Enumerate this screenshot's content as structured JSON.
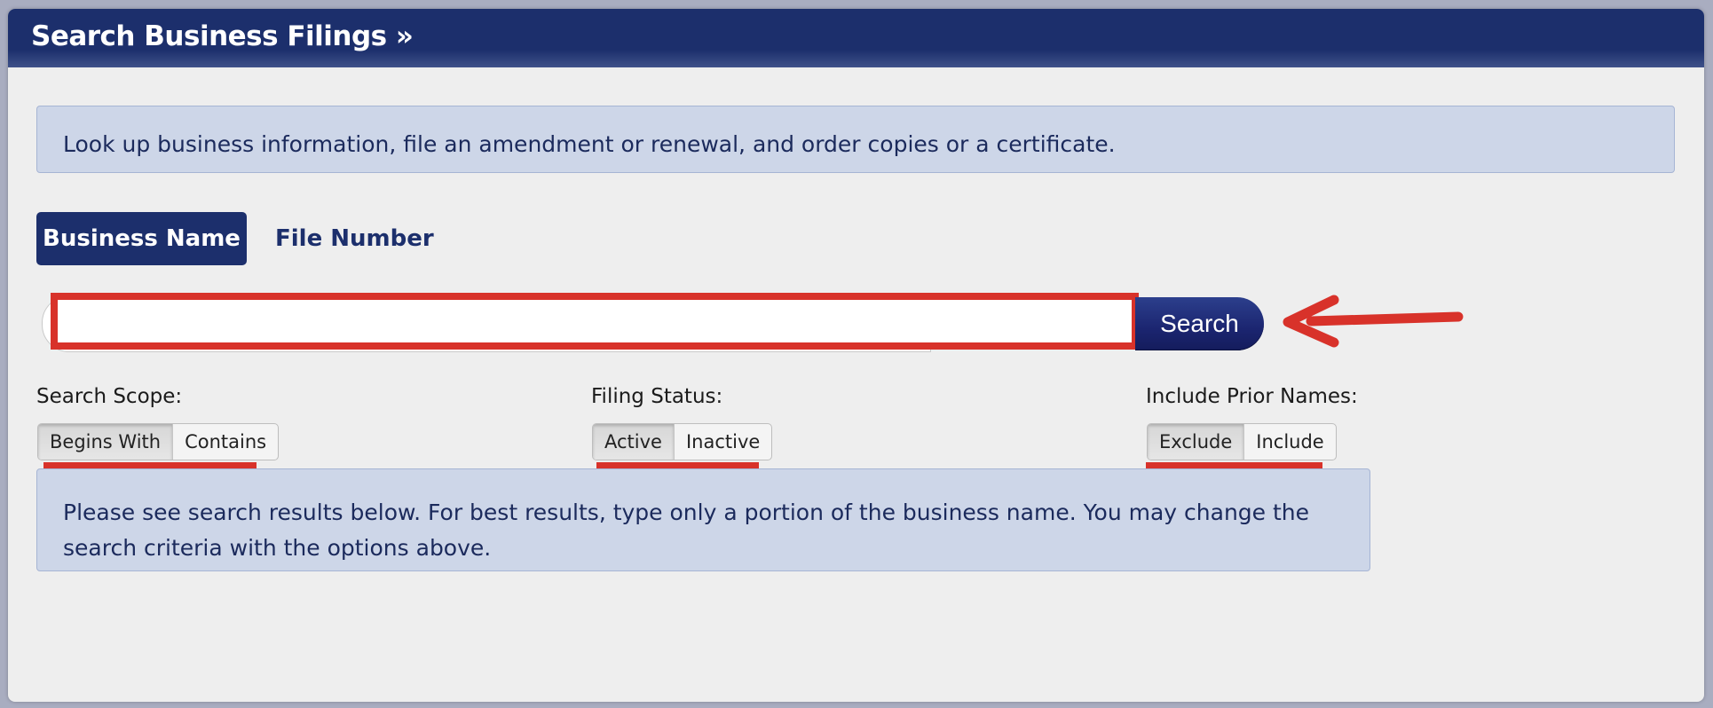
{
  "header": {
    "title": "Search Business Filings »"
  },
  "intro": {
    "text": "Look up business information, file an amendment or renewal, and order copies or a certificate."
  },
  "tabs": [
    {
      "label": "Business Name",
      "active": true
    },
    {
      "label": "File Number",
      "active": false
    }
  ],
  "search": {
    "value": "",
    "placeholder": "",
    "button_label": "Search"
  },
  "filters": {
    "scope": {
      "label": "Search Scope:",
      "options": [
        "Begins With",
        "Contains"
      ],
      "selected": "Begins With"
    },
    "status": {
      "label": "Filing Status:",
      "options": [
        "Active",
        "Inactive"
      ],
      "selected": "Active"
    },
    "prior_names": {
      "label": "Include Prior Names:",
      "options": [
        "Exclude",
        "Include"
      ],
      "selected": "Exclude"
    }
  },
  "results_note": {
    "line1": "Please see search results below. For best results, type only a portion of the business name. You may change the",
    "line2": "search criteria with the options above."
  },
  "colors": {
    "header_navy": "#1c2f6c",
    "info_box_bg": "#cdd6e8",
    "annotation_red": "#d8322a"
  },
  "annotations": {
    "arrow_icon": "left-arrow-annotation"
  }
}
